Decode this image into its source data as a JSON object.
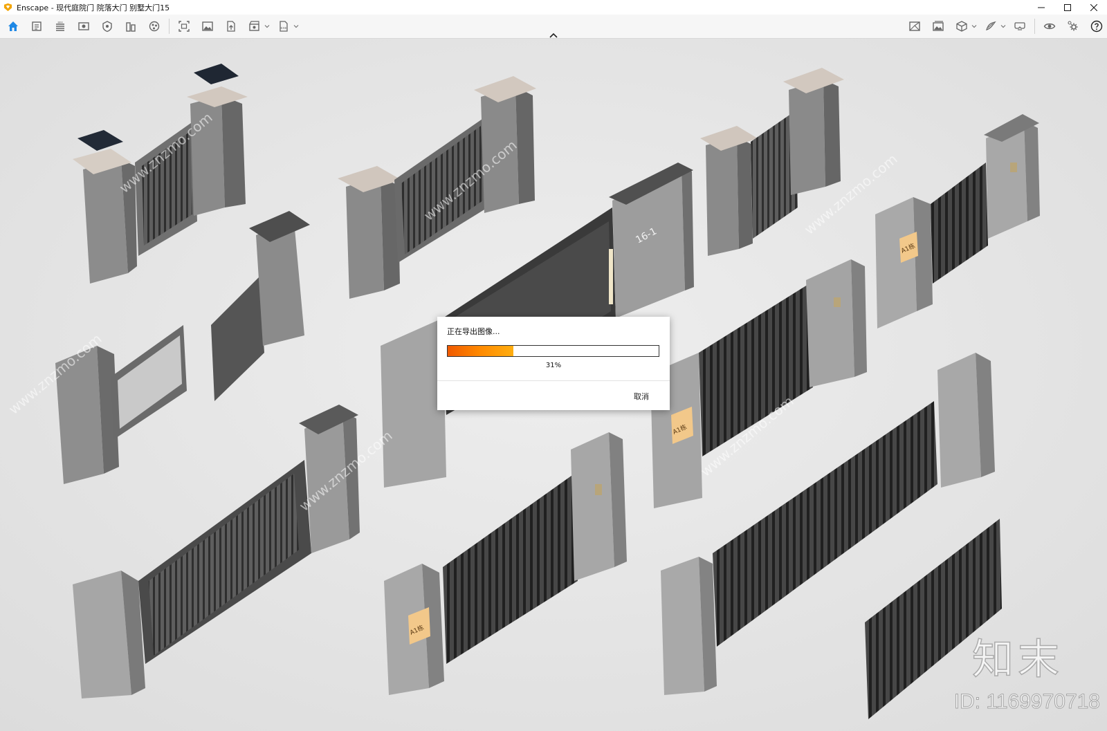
{
  "window": {
    "title": "Enscape - 现代庭院门 院落大门 别墅大门15",
    "minimize_icon": "minimize-icon",
    "maximize_icon": "maximize-icon",
    "close_icon": "close-icon"
  },
  "toolbar": {
    "left_icons": [
      "home-icon",
      "assets-icon",
      "bim-icon",
      "views-icon",
      "visual-settings-icon",
      "site-context-icon",
      "materials-icon"
    ],
    "export_icons": [
      "screenshot-icon",
      "render-image-icon",
      "upload-icon",
      "batch-render-icon",
      "export-file-icon"
    ],
    "right_icons": [
      "view-management-icon",
      "image-library-icon",
      "cube-view-icon",
      "sketch-icon",
      "vr-headset-icon",
      "visibility-icon",
      "settings-icon",
      "help-icon"
    ],
    "collapse_icon": "chevron-up-icon"
  },
  "dialog": {
    "title": "正在导出图像...",
    "progress": 0.31,
    "progress_label": "31%",
    "cancel_label": "取消"
  },
  "scene": {
    "signs": [
      "16-1",
      "A1栋",
      "A1栋",
      "A1栋"
    ],
    "overlay_text": "www.znzmo.com"
  },
  "watermark": {
    "logo": "知末",
    "id": "ID: 1169970718"
  },
  "colors": {
    "accent": "#1e88e5",
    "progress": "#ff7a00",
    "background": "#e3e3e3"
  }
}
